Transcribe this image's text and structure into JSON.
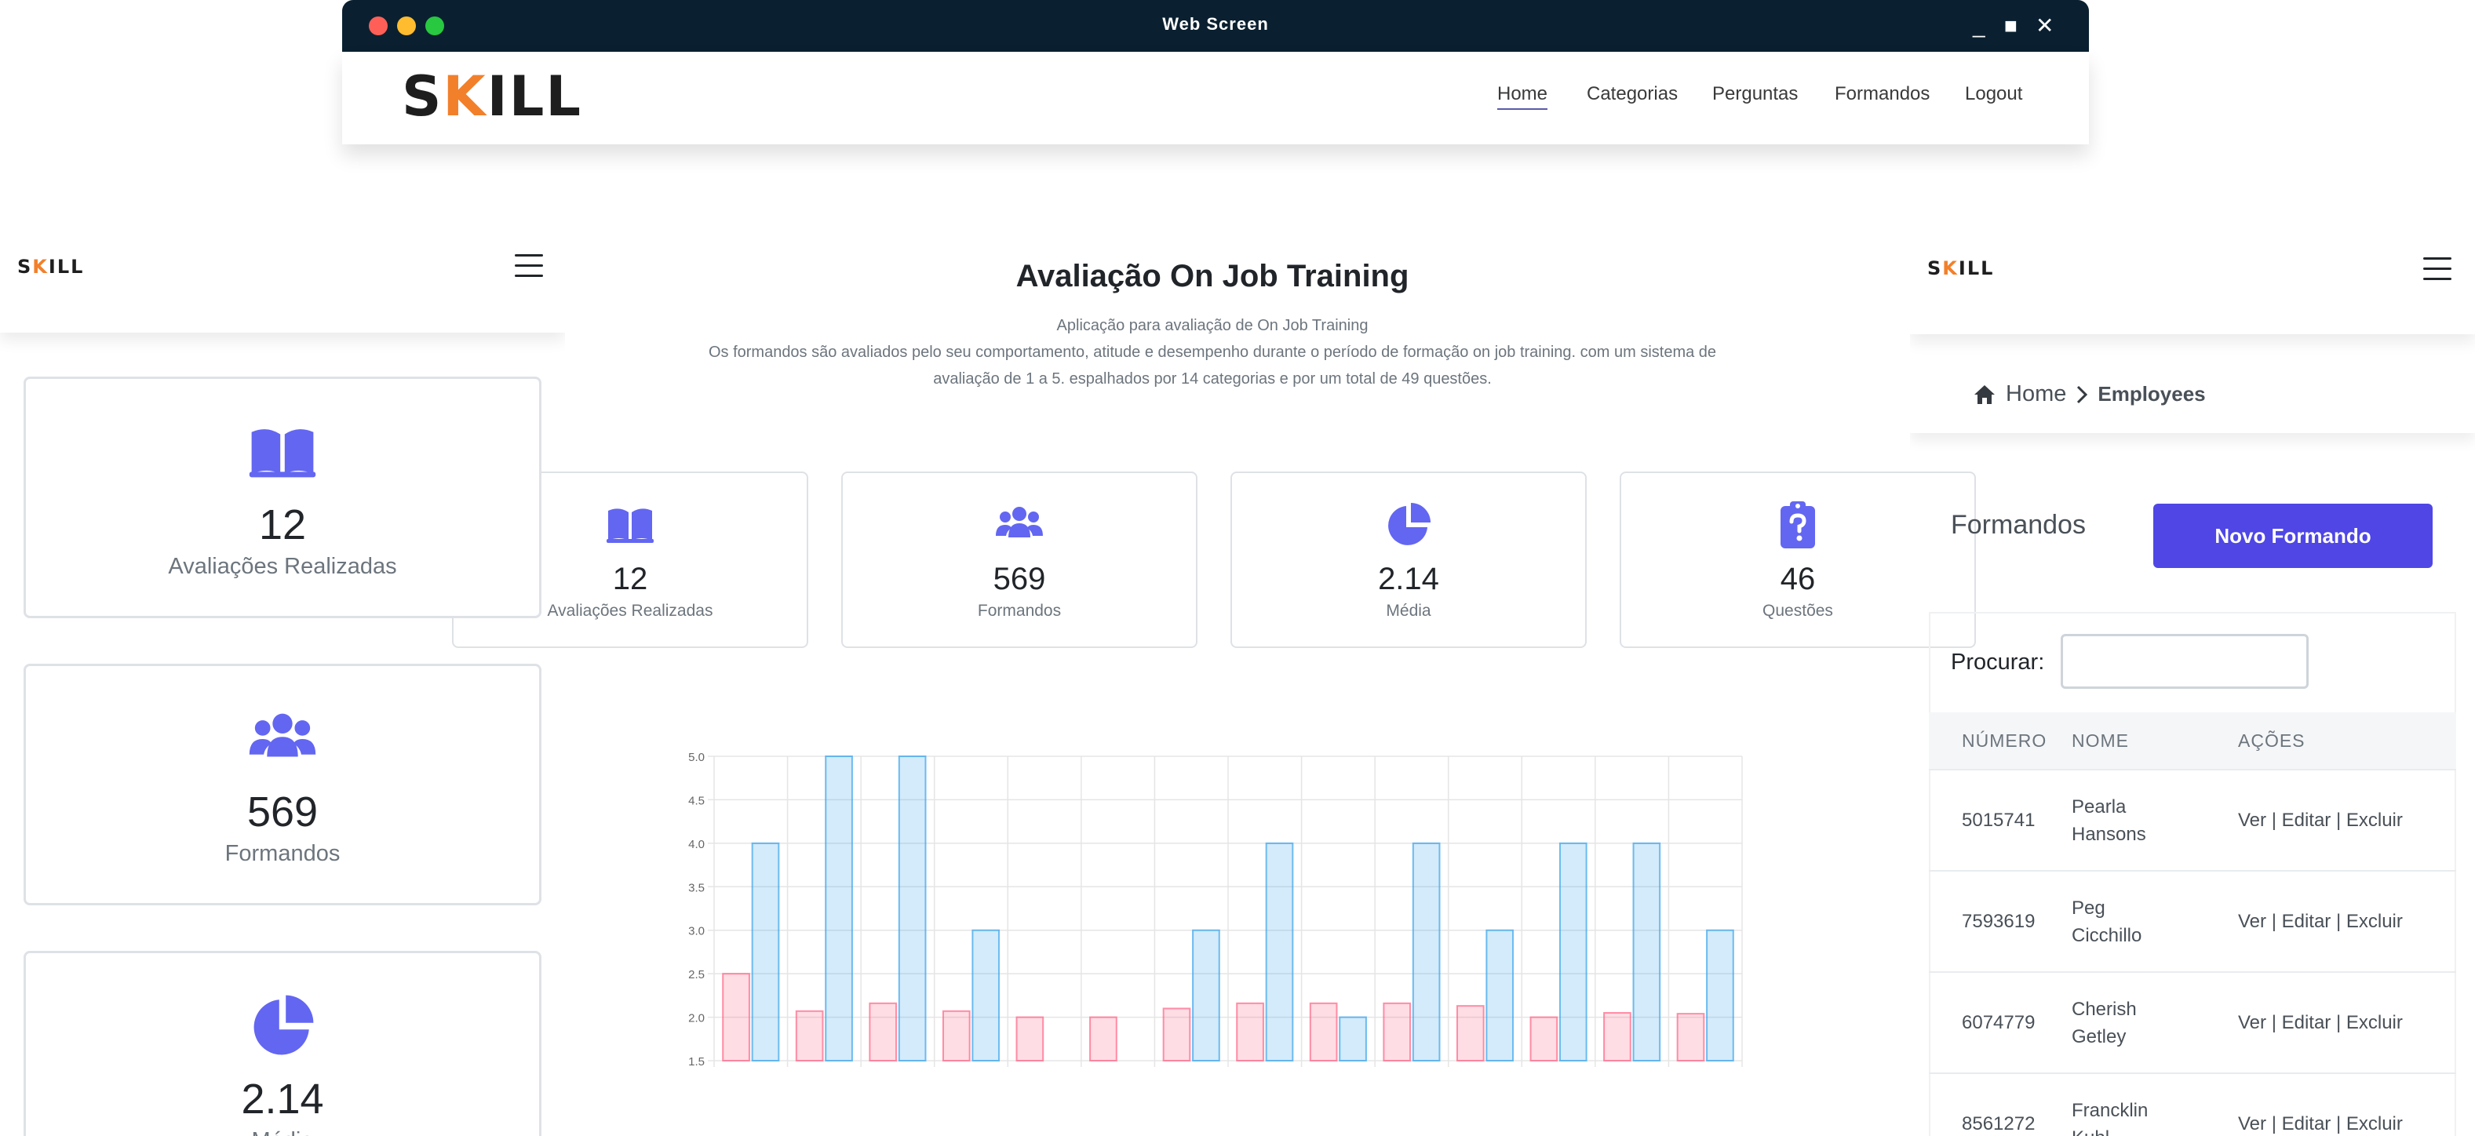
{
  "window": {
    "title": "Web Screen",
    "controls": [
      "_",
      "■",
      "✕"
    ]
  },
  "brand": {
    "logo_prefix": "S",
    "logo_k": "K",
    "logo_suffix": "ILL"
  },
  "nav": {
    "items": [
      {
        "label": "Home",
        "active": true
      },
      {
        "label": "Categorias"
      },
      {
        "label": "Perguntas"
      },
      {
        "label": "Formandos"
      },
      {
        "label": "Logout"
      }
    ]
  },
  "hero": {
    "title": "Avaliação On Job Training",
    "subtitle": "Aplicação para avaliação de On Job Training",
    "description": "Os formandos são avaliados pelo seu comportamento, atitude e desempenho durante o período de formação on job training. com um sistema de avaliação de 1 a 5. espalhados por 14 categorias e por um total de 49 questões."
  },
  "stats": [
    {
      "icon": "book-open-icon",
      "value": "12",
      "label": "Avaliações Realizadas"
    },
    {
      "icon": "users-icon",
      "value": "569",
      "label": "Formandos"
    },
    {
      "icon": "pie-chart-icon",
      "value": "2.14",
      "label": "Média"
    },
    {
      "icon": "clipboard-question-icon",
      "value": "46",
      "label": "Questões"
    }
  ],
  "chart_data": {
    "type": "bar",
    "ylim": [
      1.5,
      5.0
    ],
    "yticks": [
      "5.0",
      "4.5",
      "4.0",
      "3.5",
      "3.0",
      "2.5",
      "2.0",
      "1.5"
    ],
    "colors": {
      "series1": "#ff6384",
      "series2": "#36a2eb"
    },
    "series": [
      {
        "values": [
          2.5,
          2.07,
          2.16,
          2.07,
          2.0,
          2.0,
          2.1,
          2.16,
          2.16,
          2.16,
          2.13,
          2.0,
          2.05,
          2.04
        ]
      },
      {
        "values": [
          4.0,
          5.0,
          5.0,
          3.0,
          null,
          null,
          3.0,
          4.0,
          2.0,
          4.0,
          3.0,
          4.0,
          4.0,
          3.0
        ]
      }
    ]
  },
  "mobile_left": {
    "cards": [
      {
        "icon": "book-open-icon",
        "value": "12",
        "label": "Avaliações Realizadas"
      },
      {
        "icon": "users-icon",
        "value": "569",
        "label": "Formandos"
      },
      {
        "icon": "pie-chart-icon",
        "value": "2.14",
        "label": "Média"
      }
    ]
  },
  "mobile_right": {
    "breadcrumb": {
      "home": "Home",
      "current": "Employees"
    },
    "title": "Formandos",
    "new_button": "Novo Formando",
    "search_label": "Procurar:",
    "table": {
      "headers": [
        "NÚMERO",
        "NOME",
        "AÇÕES"
      ],
      "rows": [
        {
          "number": "5015741",
          "first": "Pearla",
          "last": "Hansons",
          "actions": "Ver | Editar | Excluir"
        },
        {
          "number": "7593619",
          "first": "Peg",
          "last": "Cicchillo",
          "actions": "Ver | Editar | Excluir"
        },
        {
          "number": "6074779",
          "first": "Cherish",
          "last": "Getley",
          "actions": "Ver | Editar | Excluir"
        },
        {
          "number": "8561272",
          "first": "Francklin",
          "last": "Kuhl",
          "actions": "Ver | Editar | Excluir"
        }
      ]
    }
  }
}
